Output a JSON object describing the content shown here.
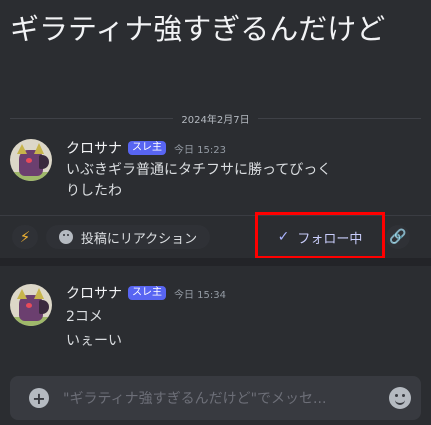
{
  "thread": {
    "title": "ギラティナ強すぎるんだけど"
  },
  "date_divider": "2024年2月7日",
  "messages": [
    {
      "author": "クロサナ",
      "badge": "スレ主",
      "time": "今日 15:23",
      "lines": [
        "いぶきギラ普通にタチフサに勝ってびっく",
        "りしたわ"
      ]
    },
    {
      "author": "クロサナ",
      "badge": "スレ主",
      "time": "今日 15:34",
      "lines": [
        "2コメ",
        "いぇーい"
      ]
    }
  ],
  "actions": {
    "react_label": "投稿にリアクション",
    "follow_label": "フォロー中"
  },
  "composer": {
    "placeholder": "\"ギラティナ強すぎるんだけど\"でメッセ..."
  },
  "colors": {
    "highlight_box": "#ff0000",
    "badge": "#5865f2",
    "background": "#2b2d31"
  }
}
